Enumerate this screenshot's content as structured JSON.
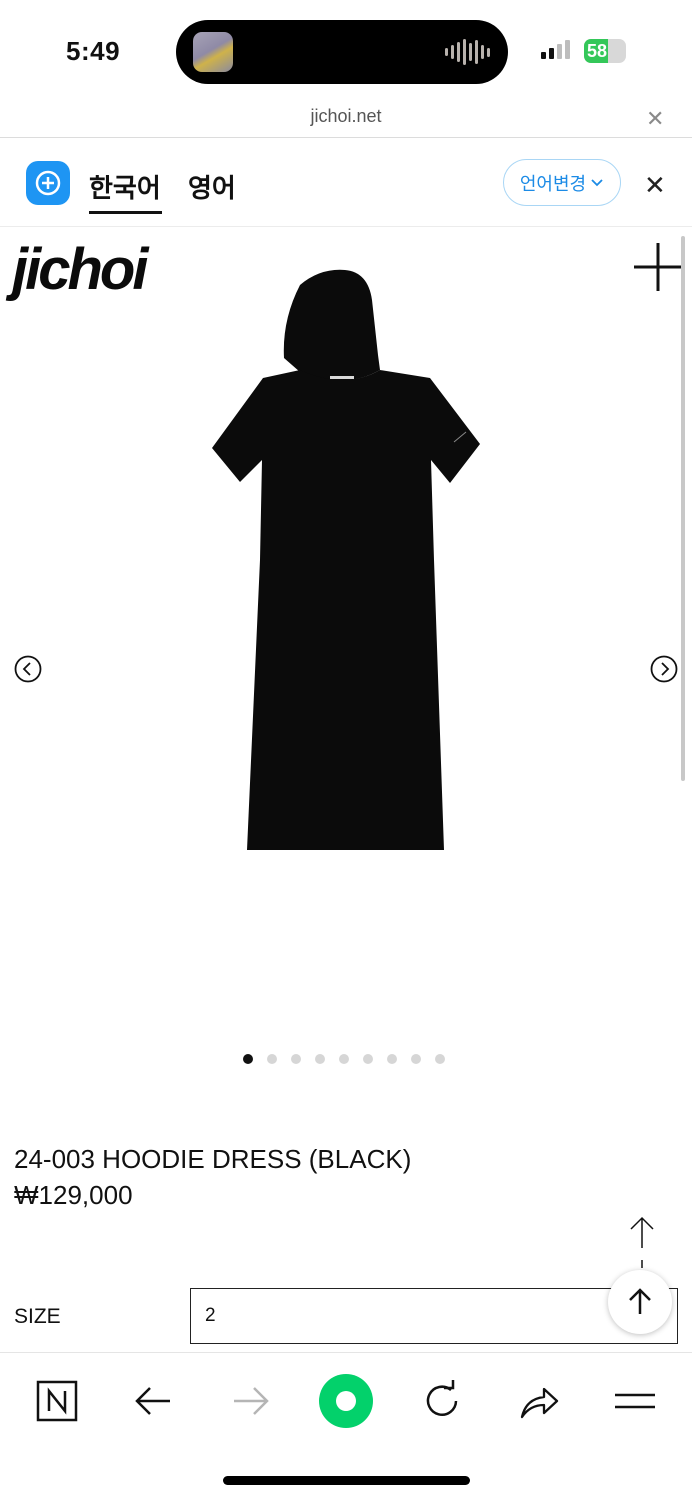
{
  "status_bar": {
    "time": "5:49",
    "battery": "58",
    "battery_level": 0.58
  },
  "browser": {
    "url": "jichoi.net"
  },
  "translate_bar": {
    "tab_korean": "한국어",
    "tab_english": "영어",
    "change_language": "언어변경"
  },
  "site": {
    "logo": "jichoi"
  },
  "gallery": {
    "image_count": 9,
    "active_index": 0
  },
  "product": {
    "name": "24-003 HOODIE DRESS (BLACK)",
    "price": "₩129,000",
    "size_label": "SIZE",
    "size_value": "2"
  },
  "colors": {
    "accent": "#1e95f3",
    "naver_green": "#03d16b",
    "battery_green": "#34c759"
  },
  "icons": [
    "naver-n-icon",
    "back-arrow-icon",
    "forward-arrow-icon",
    "naver-home-icon",
    "reload-icon",
    "share-icon",
    "menu-icon"
  ]
}
